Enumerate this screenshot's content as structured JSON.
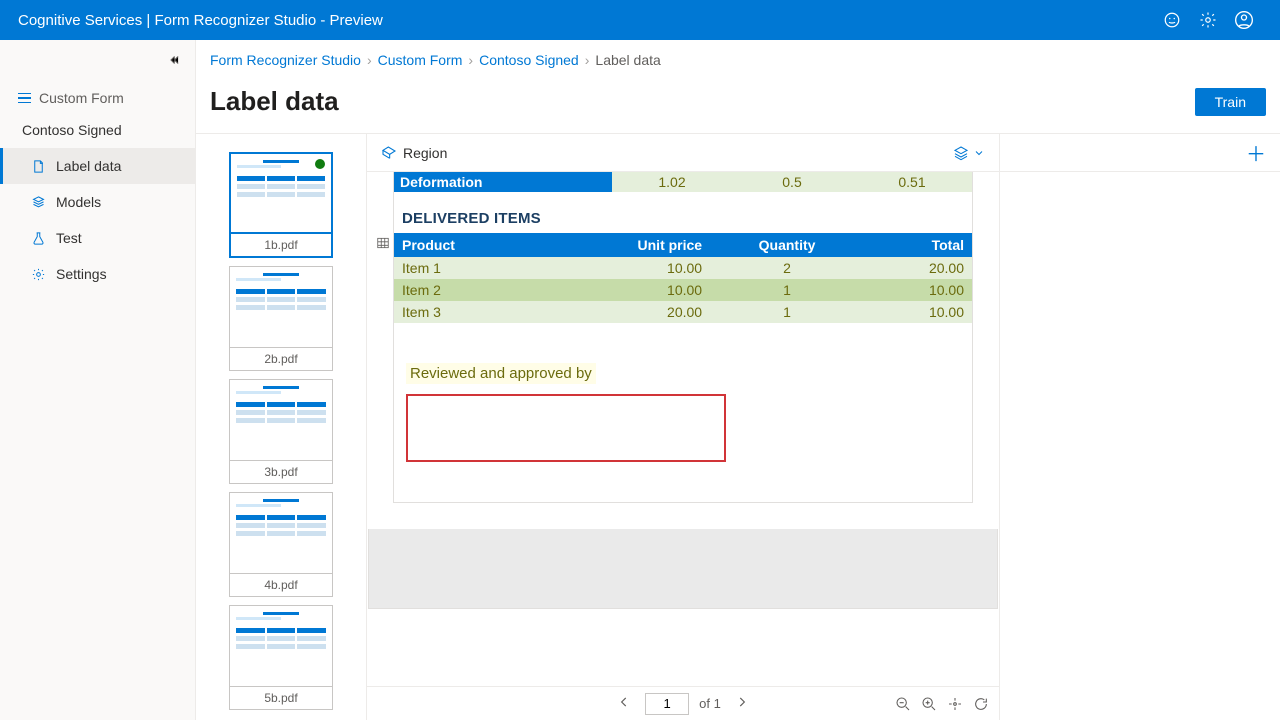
{
  "topbar": {
    "title": "Cognitive Services | Form Recognizer Studio - Preview"
  },
  "sidebar": {
    "service_label": "Custom Form",
    "project_name": "Contoso Signed",
    "items": [
      {
        "label": "Label data"
      },
      {
        "label": "Models"
      },
      {
        "label": "Test"
      },
      {
        "label": "Settings"
      }
    ]
  },
  "breadcrumb": {
    "a": "Form Recognizer Studio",
    "b": "Custom Form",
    "c": "Contoso Signed",
    "d": "Label data"
  },
  "page": {
    "title": "Label data",
    "train_label": "Train"
  },
  "doc_toolbar": {
    "region_label": "Region"
  },
  "thumbs": [
    {
      "name": "1b.pdf"
    },
    {
      "name": "2b.pdf"
    },
    {
      "name": "3b.pdf"
    },
    {
      "name": "4b.pdf"
    },
    {
      "name": "5b.pdf"
    }
  ],
  "document": {
    "cut_row": {
      "label": "Deformation",
      "v1": "1.02",
      "v2": "0.5",
      "v3": "0.51"
    },
    "section_title": "DELIVERED ITEMS",
    "table": {
      "headers": {
        "product": "Product",
        "unit": "Unit price",
        "qty": "Quantity",
        "total": "Total"
      },
      "rows": [
        {
          "product": "Item 1",
          "unit": "10.00",
          "qty": "2",
          "total": "20.00"
        },
        {
          "product": "Item 2",
          "unit": "10.00",
          "qty": "1",
          "total": "10.00"
        },
        {
          "product": "Item 3",
          "unit": "20.00",
          "qty": "1",
          "total": "10.00"
        }
      ]
    },
    "review_label": "Reviewed and approved by"
  },
  "pager": {
    "page": "1",
    "of_label": "of 1"
  }
}
